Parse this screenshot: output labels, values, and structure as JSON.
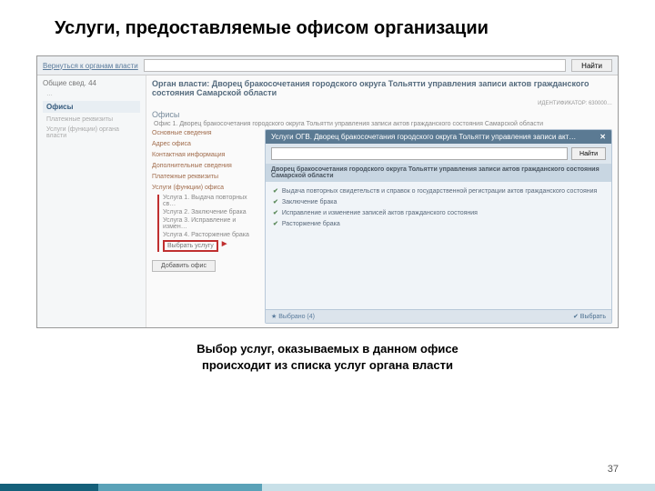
{
  "title": "Услуги, предоставляемые офисом организации",
  "caption_l1": "Выбор услуг, оказываемых в данном офисе",
  "caption_l2": "происходит из списка услуг органа власти",
  "page": "37",
  "topbar": {
    "back": "Вернуться к органам власти",
    "search_btn": "Найти"
  },
  "leftnav": {
    "header": "Общие свед. 44",
    "sub": "…",
    "active": "Офисы",
    "item1": "Платежные реквизиты",
    "item2": "Услуги (функции) органа власти"
  },
  "org": {
    "prefix": "Орган власти:",
    "name": "Дворец бракосочетания городского округа Тольятти управления записи актов гражданского состояния Самарской области",
    "meta": "ИДЕНТИФИКАТОР: 630000…"
  },
  "section": {
    "label": "Офисы",
    "sub": "Офис 1. Дворец бракосочетания городского округа Тольятти управления записи актов гражданского состояния Самарской области"
  },
  "sidemenu": {
    "i1": "Основные сведения",
    "i2": "Адрес офиса",
    "i3": "Контактная информация",
    "i4": "Дополнительные сведения",
    "i5": "Платежные реквизиты",
    "grp": "Услуги (функции) офиса",
    "u1": "Услуга 1. Выдача повторных св…",
    "u2": "Услуга 2. Заключение брака",
    "u3": "Услуга 3. Исправление и измен…",
    "u4": "Услуга 4. Расторжение брака",
    "select": "Выбрать услугу",
    "add": "Добавить офис"
  },
  "panel": {
    "hdr": "Услуги ОГВ. Дворец бракосочетания городского округа Тольятти управления записи акт…",
    "search_btn": "Найти",
    "result_hdr": "Дворец бракосочетания городского округа Тольятти управления записи актов гражданского состояния Самарской области",
    "c1": "Выдача повторных свидетельств и справок о государственной регистрации актов гражданского состояния",
    "c2": "Заключение брака",
    "c3": "Исправление и изменение записей актов гражданского состояния",
    "c4": "Расторжение брака",
    "footer_count": "Выбрано (4)",
    "footer_sel": "Выбрать"
  }
}
